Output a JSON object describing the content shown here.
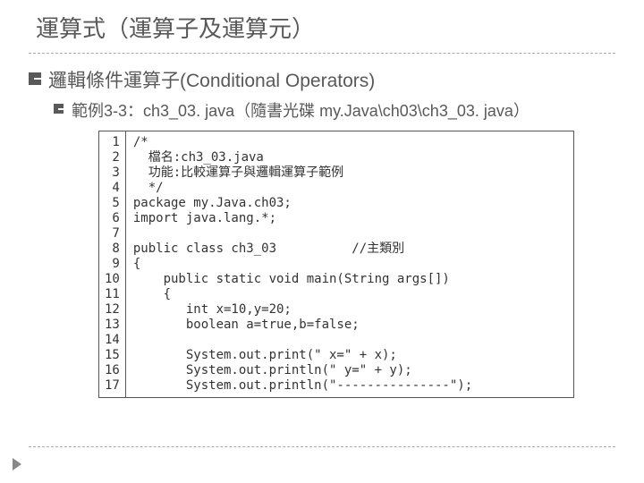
{
  "title": "運算式（運算子及運算元）",
  "h1": "邏輯條件運算子(Conditional Operators)",
  "h2": "範例3-3：ch3_03. java（隨書光碟 my.Java\\ch03\\ch3_03. java）",
  "gutter": "1\n2\n3\n4\n5\n6\n7\n8\n9\n10\n11\n12\n13\n14\n15\n16\n17",
  "code": "/*\n  檔名:ch3_03.java\n  功能:比較運算子與邏輯運算子範例\n  */\npackage my.Java.ch03;\nimport java.lang.*;\n\npublic class ch3_03          //主類別\n{\n    public static void main(String args[])\n    {\n       int x=10,y=20;\n       boolean a=true,b=false;\n\n       System.out.print(\" x=\" + x);\n       System.out.println(\" y=\" + y);\n       System.out.println(\"---------------\");"
}
